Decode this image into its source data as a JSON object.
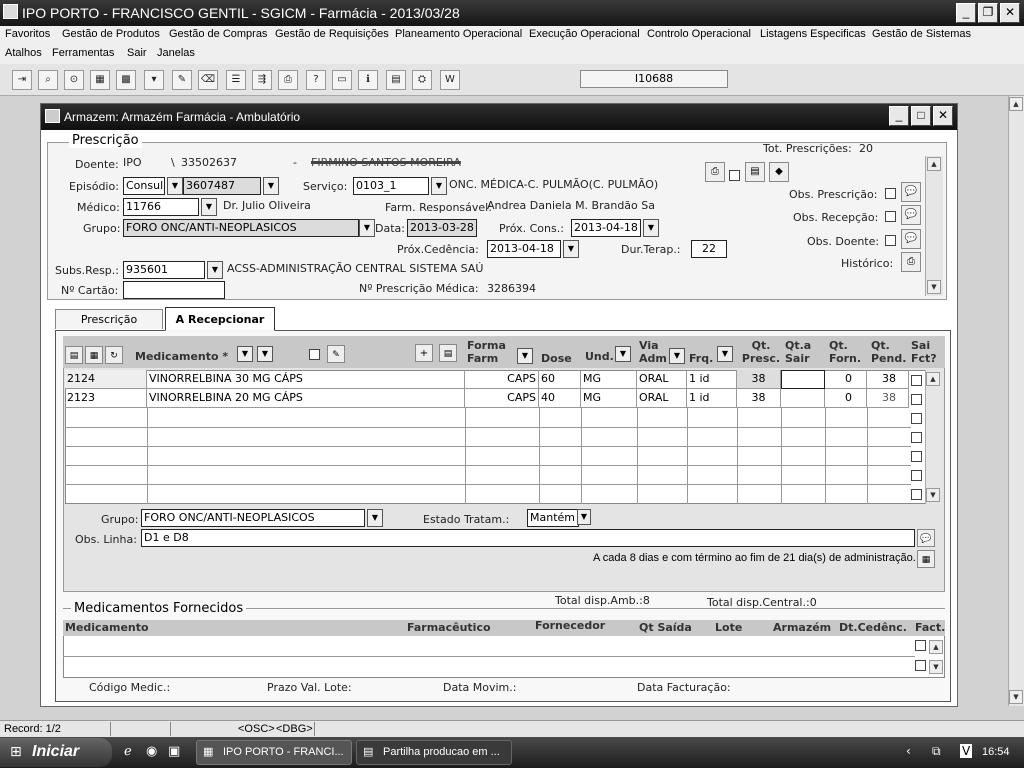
{
  "app": {
    "title": "IPO PORTO - FRANCISCO GENTIL  -  SGICM - Farmácia  -  2013/03/28"
  },
  "menu": {
    "row1": [
      "Favoritos",
      "Gestão de Produtos",
      "Gestão de Compras",
      "Gestão de Requisições",
      "Planeamento Operacional",
      "Execução Operacional",
      "Controlo Operacional",
      "Listagens Especificas",
      "Gestão de Sistemas"
    ],
    "row2": [
      "Atalhos",
      "Ferramentas",
      "Sair",
      "Janelas"
    ]
  },
  "toolbar": {
    "code": "I10688"
  },
  "window": {
    "title": "Armazem: Armazém Farmácia - Ambulatório"
  },
  "prescricao": {
    "section_title": "Prescrição",
    "tot_label": "Tot. Prescrições:",
    "tot_value": "20",
    "doente_label": "Doente:",
    "doente_inst": "IPO",
    "doente_sep": "\\",
    "doente_num": "33502637",
    "doente_dash": "-",
    "doente_name": "FIRMINO SANTOS MOREIRA",
    "episodio_label": "Episódio:",
    "episodio_type": "Consul",
    "episodio_num": "3607487",
    "servico_label": "Serviço:",
    "servico_code": "0103_1",
    "servico_desc": "ONC. MÉDICA-C. PULMÃO(C. PULMÃO)",
    "medico_label": "Médico:",
    "medico_code": "11766",
    "medico_name": "Dr. Julio Oliveira",
    "farm_label": "Farm. Responsável:",
    "farm_name": "Andrea Daniela M. Brandão Sa",
    "grupo_label": "Grupo:",
    "grupo_value": "FORO ONC/ANTI-NEOPLASICOS",
    "data_label": "Data:",
    "data_value": "2013-03-28",
    "prox_cons_label": "Próx. Cons.:",
    "prox_cons_value": "2013-04-18",
    "prox_ced_label": "Próx.Cedência:",
    "prox_ced_value": "2013-04-18",
    "dur_label": "Dur.Terap.:",
    "dur_value": "22",
    "subs_label": "Subs.Resp.:",
    "subs_code": "935601",
    "subs_desc": "ACSS-ADMINISTRAÇÃO CENTRAL SISTEMA SAÚ",
    "cartao_label": "Nº Cartão:",
    "cartao_value": "",
    "presc_med_label": "Nº Prescrição Médica:",
    "presc_med_value": "3286394",
    "obs_presc_label": "Obs. Prescrição:",
    "obs_recep_label": "Obs. Recepção:",
    "obs_doente_label": "Obs. Doente:",
    "historico_label": "Histórico:"
  },
  "tabs": [
    "Prescrição",
    "A Recepcionar"
  ],
  "grid": {
    "medicamento_header": "Medicamento *",
    "headers": [
      "Forma Farm",
      "Dose",
      "Und.",
      "Via Adm",
      "Frq.",
      "Qt. Presc.",
      "Qt.a Sair",
      "Qt. Forn.",
      "Qt. Pend.",
      "Sai Fct?"
    ],
    "rows": [
      {
        "code": "2124",
        "name": "VINORRELBINA 30 MG CÁPS",
        "forma": "CAPS",
        "dose": "60",
        "und": "MG",
        "via": "ORAL",
        "frq": "1 id",
        "qt_presc": "38",
        "qt_sair": "",
        "qt_forn": "0",
        "qt_pend": "38"
      },
      {
        "code": "2123",
        "name": "VINORRELBINA 20 MG CÁPS",
        "forma": "CAPS",
        "dose": "40",
        "und": "MG",
        "via": "ORAL",
        "frq": "1 id",
        "qt_presc": "38",
        "qt_sair": "",
        "qt_forn": "0",
        "qt_pend": "38"
      }
    ],
    "grupo_label": "Grupo:",
    "grupo_value": "FORO ONC/ANTI-NEOPLASICOS",
    "estado_label": "Estado Tratam.:",
    "estado_value": "Mantém",
    "obs_linha_label": "Obs. Linha:",
    "obs_linha_value": "D1 e D8",
    "note": "A cada 8 dias e com término ao fim de 21 dia(s) de administração."
  },
  "fornecidos": {
    "total_amb": "Total disp.Amb.:8",
    "total_central": "Total disp.Central.:0",
    "section_title": "Medicamentos Fornecidos",
    "headers": [
      "Medicamento",
      "Farmacêutico",
      "Fornecedor",
      "Qt Saída",
      "Lote",
      "Armazém",
      "Dt.Cedênc.",
      "Fact."
    ],
    "footer": [
      "Código Medic.:",
      "Prazo Val. Lote:",
      "Data Movim.:",
      "Data Facturação:"
    ]
  },
  "status": {
    "record": "Record: 1/2",
    "osc": "<OSC>",
    "dbg": "<DBG>"
  },
  "taskbar": {
    "start": "Iniciar",
    "task1": "IPO PORTO - FRANCI...",
    "task2": "Partilha producao em ...",
    "clock": "16:54"
  }
}
